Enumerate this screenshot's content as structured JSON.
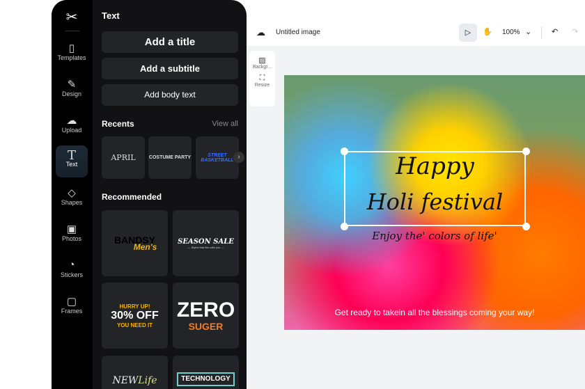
{
  "rail": [
    {
      "label": "Templates",
      "icon": "templates-icon"
    },
    {
      "label": "Design",
      "icon": "design-icon"
    },
    {
      "label": "Upload",
      "icon": "upload-icon"
    },
    {
      "label": "Text",
      "icon": "text-icon"
    },
    {
      "label": "Shapes",
      "icon": "shapes-icon"
    },
    {
      "label": "Photos",
      "icon": "photos-icon"
    },
    {
      "label": "Stickers",
      "icon": "stickers-icon"
    },
    {
      "label": "Frames",
      "icon": "frames-icon"
    }
  ],
  "panel": {
    "title": "Text",
    "add_title": "Add a title",
    "add_subtitle": "Add a subtitle",
    "add_body": "Add body text",
    "recents": "Recents",
    "view_all": "View all",
    "recommended": "Recommended",
    "recent_items": [
      "APRIL",
      "COSTUME PARTY",
      "STREET BASKETBALL"
    ],
    "cards": {
      "c1a": "BANDSY",
      "c1b": "Men's",
      "c2a": "SEASON SALE",
      "c2b": "— Styles that flex with you —",
      "c3a": "HURRY UP!",
      "c3b": "30% OFF",
      "c3c": "YOU NEED IT",
      "c4a": "ZERO",
      "c4b": "SUGER",
      "c5a": "NEW",
      "c5b": "Life",
      "c6": "TECHNOLOGY"
    }
  },
  "toolbar": {
    "doc_title": "Untitled image",
    "zoom": "100%"
  },
  "tools": {
    "background": "Backgr...",
    "resize": "Resize"
  },
  "canvas": {
    "line1": "Happy",
    "line2": "Holi festival",
    "tagline": "Enjoy the' colors of life'",
    "footer": "Get ready to takein all the blessings coming your way!"
  }
}
